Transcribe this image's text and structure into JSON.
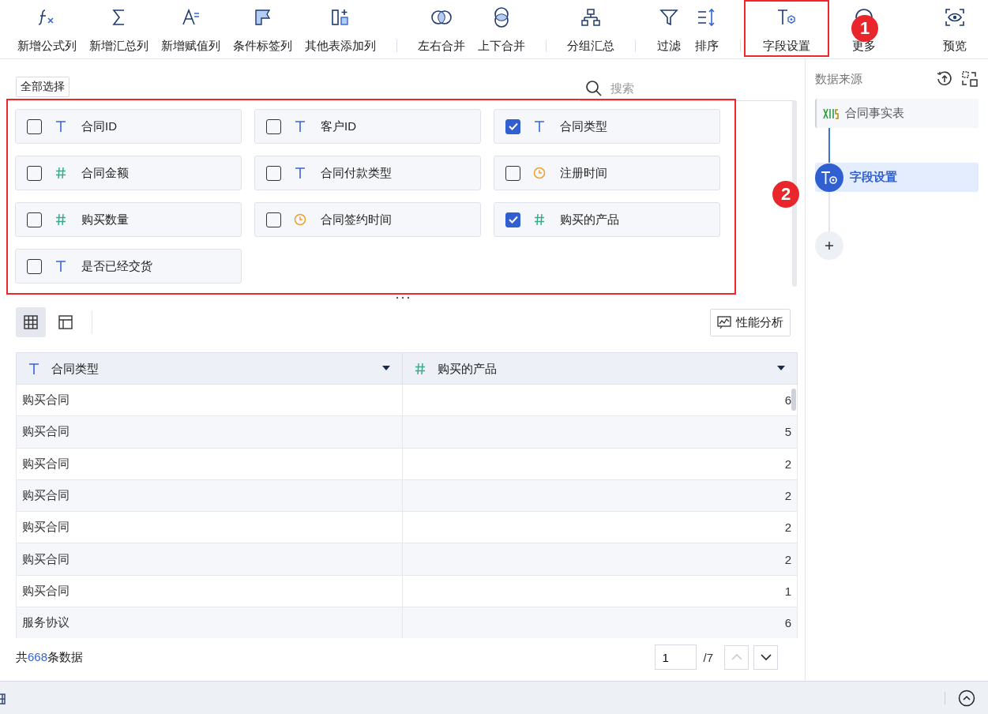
{
  "toolbar": [
    {
      "label": "新增公式列",
      "selected": false,
      "separator_after": false
    },
    {
      "label": "新增汇总列",
      "selected": false,
      "separator_after": false
    },
    {
      "label": "新增赋值列",
      "selected": false,
      "separator_after": false
    },
    {
      "label": "条件标签列",
      "selected": false,
      "separator_after": false
    },
    {
      "label": "其他表添加列",
      "selected": false,
      "separator_after": true
    },
    {
      "label": "左右合并",
      "selected": false,
      "separator_after": false
    },
    {
      "label": "上下合并",
      "selected": false,
      "separator_after": true
    },
    {
      "label": "分组汇总",
      "selected": false,
      "separator_after": true
    },
    {
      "label": "过滤",
      "selected": false,
      "separator_after": false
    },
    {
      "label": "排序",
      "selected": false,
      "separator_after": true
    },
    {
      "label": "字段设置",
      "selected": true,
      "separator_after": false
    },
    {
      "label": "更多",
      "selected": false,
      "separator_after": false
    },
    {
      "label": "预览",
      "selected": false,
      "separator_after": false
    }
  ],
  "select_all": "全部选择",
  "search": {
    "placeholder": "搜索"
  },
  "fields": [
    {
      "name": "合同ID",
      "kind": "text",
      "checked": false
    },
    {
      "name": "客户ID",
      "kind": "text",
      "checked": false
    },
    {
      "name": "合同类型",
      "kind": "text",
      "checked": true
    },
    {
      "name": "合同金额",
      "kind": "number",
      "checked": false
    },
    {
      "name": "合同付款类型",
      "kind": "text",
      "checked": false
    },
    {
      "name": "注册时间",
      "kind": "time",
      "checked": false
    },
    {
      "name": "购买数量",
      "kind": "number",
      "checked": false
    },
    {
      "name": "合同签约时间",
      "kind": "time",
      "checked": false
    },
    {
      "name": "购买的产品",
      "kind": "number",
      "checked": true
    },
    {
      "name": "是否已经交货",
      "kind": "text",
      "checked": false
    }
  ],
  "view_modes": [
    {
      "selected": true
    },
    {
      "selected": false
    }
  ],
  "analysis_button": "性能分析",
  "table": {
    "columns": [
      {
        "name": "合同类型",
        "kind": "text"
      },
      {
        "name": "购买的产品",
        "kind": "number"
      }
    ],
    "rows": [
      [
        "购买合同",
        "6"
      ],
      [
        "购买合同",
        "5"
      ],
      [
        "购买合同",
        "2"
      ],
      [
        "购买合同",
        "2"
      ],
      [
        "购买合同",
        "2"
      ],
      [
        "购买合同",
        "2"
      ],
      [
        "购买合同",
        "1"
      ],
      [
        "服务协议",
        "6"
      ]
    ]
  },
  "footer": {
    "total_prefix": "共",
    "total_count": "668",
    "total_suffix": "条数据",
    "page": "1",
    "page_total": "/7",
    "prev_disabled": true,
    "next_disabled": false
  },
  "sidebar": {
    "title": "数据来源",
    "source": "合同事实表",
    "steps": [
      {
        "label": "字段设置",
        "selected": true
      }
    ]
  },
  "annotations": [
    {
      "number": "1"
    },
    {
      "number": "2"
    }
  ]
}
